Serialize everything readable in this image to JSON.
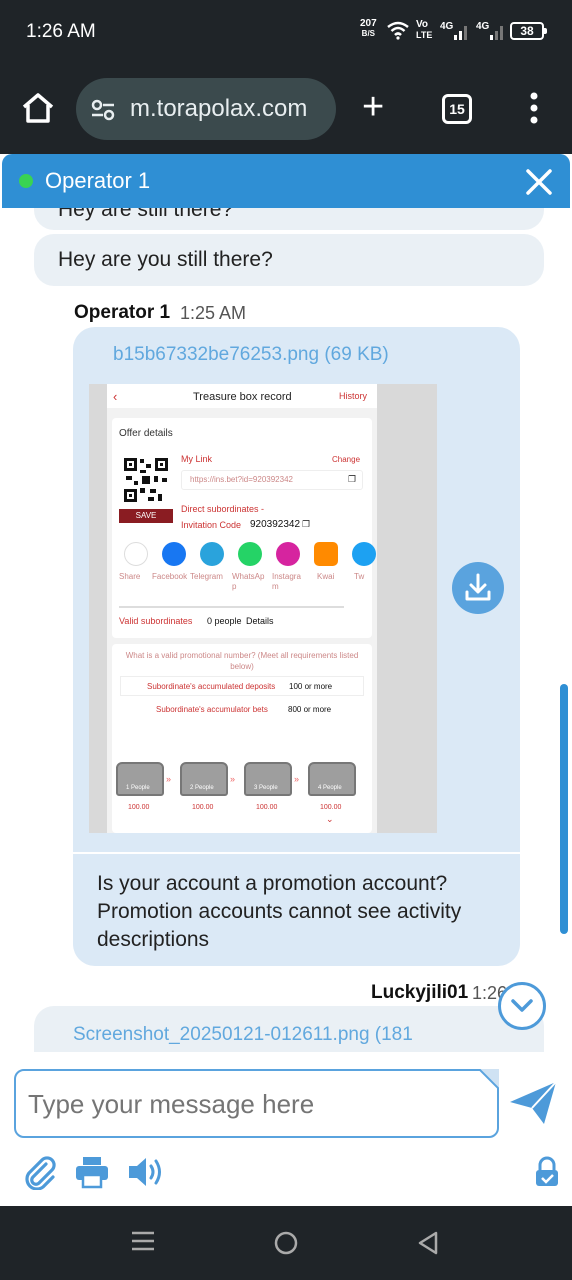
{
  "status": {
    "time": "1:26 AM",
    "net_speed_value": "207",
    "net_speed_unit": "B/S",
    "volte_top": "Vo",
    "volte_bottom": "LTE",
    "sim1": "4G",
    "sim2": "4G",
    "battery": "38"
  },
  "browser": {
    "url": "m.torapolax.com",
    "tab_count": "15"
  },
  "chat": {
    "header_title": "Operator 1",
    "prev_partial": "Hey are still there?",
    "prev_message": "Hey are you still there?",
    "op_name": "Operator 1",
    "op_time": "1:25 AM",
    "file_name": "b15b67332be76253.png (69 KB)",
    "op_message": "Is your account a promotion account? Promotion accounts cannot see activity descriptions",
    "user_name": "Luckyjili01",
    "user_time": "1:26 AM",
    "user_file": "Screenshot_20250121-012611.png (181",
    "input_placeholder": "Type your message here"
  },
  "shot": {
    "title": "Treasure box record",
    "history": "History",
    "offer_details": "Offer details",
    "my_link": "My Link",
    "change": "Change",
    "link_url": "https://ins.bet?id=920392342",
    "save": "SAVE",
    "direct_sub": "Direct subordinates -",
    "invite_label": "Invitation Code",
    "invite_code": "920392342",
    "share_labels": [
      "Share",
      "Facebook",
      "Telegram",
      "WhatsAp p",
      "Instagra m",
      "Kwai",
      "Tw"
    ],
    "valid_label": "Valid subordinates",
    "valid_count": "0 people",
    "details": "Details",
    "valid_question": "What is a valid promotional number? (Meet all requirements listed below)",
    "req1_label": "Subordinate's accumulated deposits",
    "req1_value": "100 or more",
    "req2_label": "Subordinate's accumulator bets",
    "req2_value": "800 or more",
    "chests": [
      {
        "label": "1 People",
        "amount": "100.00"
      },
      {
        "label": "2 People",
        "amount": "100.00"
      },
      {
        "label": "3 People",
        "amount": "100.00"
      },
      {
        "label": "4 People",
        "amount": "100.00"
      }
    ]
  },
  "colors": {
    "accent": "#2f8fd4",
    "bubble": "#dbe9f6",
    "link": "#61a8de",
    "online": "#39d353"
  }
}
